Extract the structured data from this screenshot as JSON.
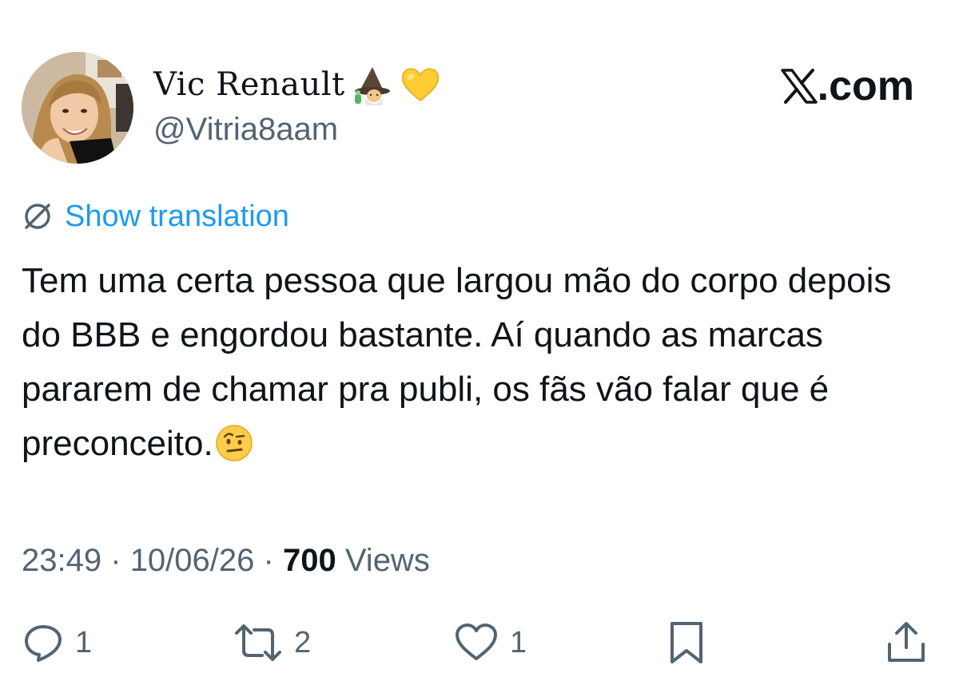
{
  "author": {
    "display_name": "Vic Renault",
    "handle": "@Vitria8aam",
    "name_emojis": [
      "mage-emoji-icon",
      "yellow-heart-emoji-icon"
    ]
  },
  "brand": {
    "text": ".com",
    "logo": "x-logo-icon"
  },
  "translation": {
    "label": "Show translation",
    "icon": "globe-icon"
  },
  "tweet": {
    "text": "Tem uma certa pessoa que largou mão do corpo depois do BBB e engordou bastante. Aí quando as marcas pararem de chamar pra publi, os fãs vão falar que é preconceito.",
    "trailing_emoji": "face-with-raised-eyebrow-emoji-icon"
  },
  "meta": {
    "time": "23:49",
    "separator": "·",
    "date": "10/06/26",
    "views_count": "700",
    "views_label": "Views"
  },
  "actions": {
    "replies": "1",
    "reposts": "2",
    "likes": "1"
  },
  "colors": {
    "text": "#0f1419",
    "secondary": "#536471",
    "link": "#1d9bf0",
    "background": "#ffffff"
  }
}
